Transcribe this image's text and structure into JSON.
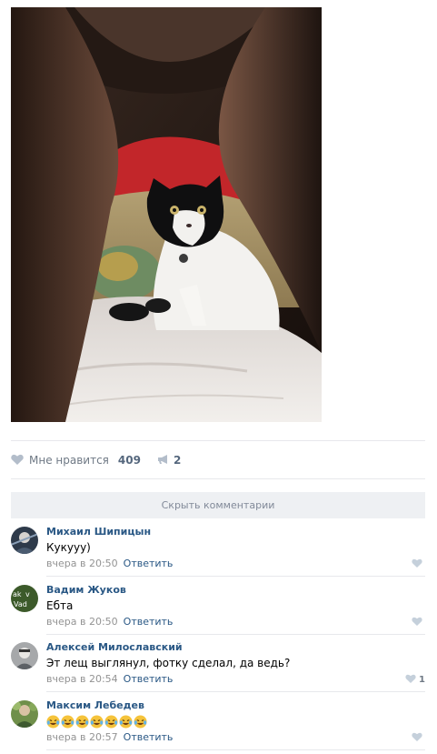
{
  "post": {
    "photo_icon": "cat-peeking-photo",
    "likes_label": "Мне нравится",
    "likes_count": "409",
    "reposts_count": "2",
    "hide_comments_label": "Скрыть комментарии"
  },
  "comments": [
    {
      "author": "Михаил Шипицын",
      "text": "Кукууу)",
      "time": "вчера в 20:50",
      "reply": "Ответить",
      "likes": ""
    },
    {
      "author": "Вадим Жуков",
      "text": "Ебта",
      "time": "вчера в 20:50",
      "reply": "Ответить",
      "likes": ""
    },
    {
      "author": "Алексей Милославский",
      "text": "Эт лещ выглянул, фотку сделал, да ведь?",
      "time": "вчера в 20:54",
      "reply": "Ответить",
      "likes": "1"
    },
    {
      "author": "Максим Лебедев",
      "text": "",
      "emoji_icon": "laughing-crying-emoji",
      "emoji_count": 7,
      "time": "вчера в 20:57",
      "reply": "Ответить",
      "likes": ""
    }
  ],
  "colors": {
    "link": "#2a5885",
    "meta": "#939393",
    "divider": "#e7e8ec",
    "button_bg": "#eef0f3"
  }
}
